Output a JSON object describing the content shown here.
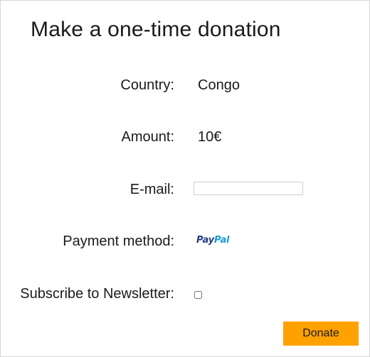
{
  "form": {
    "title": "Make a one-time donation",
    "country": {
      "label": "Country:",
      "value": "Congo"
    },
    "amount": {
      "label": "Amount:",
      "value": "10€"
    },
    "email": {
      "label": "E-mail:",
      "value": "",
      "placeholder": ""
    },
    "payment_method": {
      "label": "Payment method:",
      "logo_part1": "Pay",
      "logo_part2": "Pal"
    },
    "newsletter": {
      "label": "Subscribe to Newsletter:",
      "checked": false
    },
    "donate_button": "Donate"
  },
  "colors": {
    "accent": "#ffa200",
    "paypal_dark": "#253b80",
    "paypal_light": "#179bd7",
    "border": "#d6d6d6"
  }
}
